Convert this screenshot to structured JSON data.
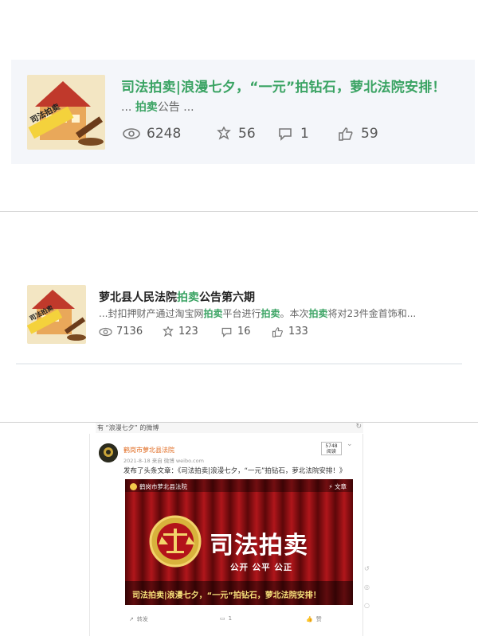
{
  "card1": {
    "title": "司法拍卖|浪漫七夕，“一元”拍钻石，萝北法院安排！",
    "snippet_prefix": "... ",
    "snippet_highlight": "拍卖",
    "snippet_suffix": "公告 ...",
    "thumb_label": "司法拍卖",
    "stats": {
      "views": "6248",
      "shares": "56",
      "comments": "1",
      "likes": "59"
    }
  },
  "card2": {
    "title_prefix": "萝北县人民法院",
    "title_highlight": "拍卖",
    "title_suffix": "公告第六期",
    "snippet": {
      "part1": "...封扣押财产通过淘宝网",
      "hl1": "拍卖",
      "part2": "平台进行",
      "hl2": "拍卖",
      "part3": "。本次",
      "hl3": "拍卖",
      "part4": "将对23件金首饰和..."
    },
    "thumb_label": "司法拍卖",
    "stats": {
      "views": "7136",
      "shares": "123",
      "comments": "16",
      "likes": "133"
    }
  },
  "weibo": {
    "topic_bar": "有 “浪漫七夕” 的微博",
    "user_name": "鹤岗市萝北县法院",
    "meta": "2021-8-18  来自 微博 weibo.com",
    "post_text": "发布了头条文章：《司法拍卖|浪漫七夕，“一元”拍钻石，萝北法院安排！》",
    "views_badge_line1": "5748",
    "views_badge_line2": "阅读",
    "banner": {
      "org": "鹤岗市萝北县法院",
      "article_tag": "⚡ 文章",
      "big_title": "司法拍卖",
      "motto": "公开 公平 公正",
      "caption": "司法拍卖|浪漫七夕，“一元”拍钻石，萝北法院安排！"
    },
    "actions": {
      "forward": "转发",
      "comments": "1",
      "like": "赞"
    }
  },
  "colors": {
    "accent_green": "#3aa363",
    "weibo_orange": "#e06a1f",
    "banner_red": "#7a0d10"
  }
}
